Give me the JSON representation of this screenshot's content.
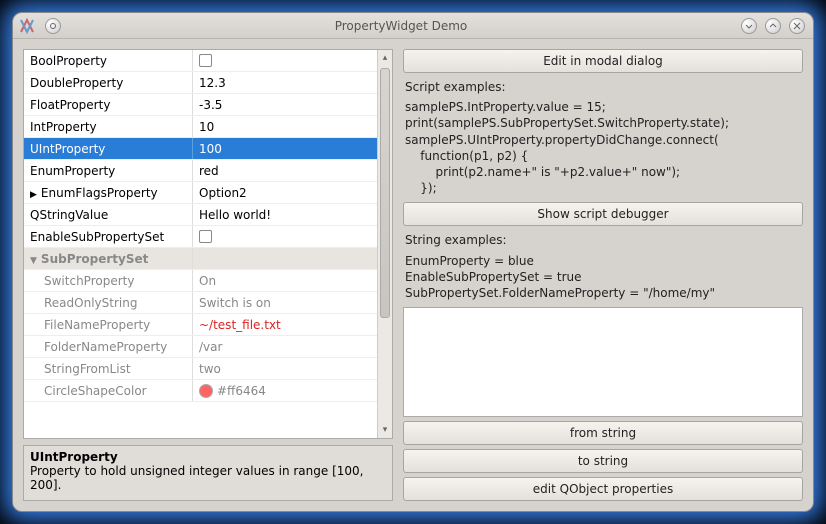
{
  "window": {
    "title": "PropertyWidget Demo"
  },
  "properties": {
    "rows": [
      {
        "name": "BoolProperty",
        "type": "checkbox",
        "value": ""
      },
      {
        "name": "DoubleProperty",
        "type": "text",
        "value": "12.3"
      },
      {
        "name": "FloatProperty",
        "type": "text",
        "value": "-3.5"
      },
      {
        "name": "IntProperty",
        "type": "text",
        "value": "10"
      },
      {
        "name": "UIntProperty",
        "type": "text",
        "value": "100",
        "selected": true
      },
      {
        "name": "EnumProperty",
        "type": "text",
        "value": "red"
      },
      {
        "name": "EnumFlagsProperty",
        "type": "text",
        "value": "Option2",
        "expandable": "right"
      },
      {
        "name": "QStringValue",
        "type": "text",
        "value": "Hello world!"
      },
      {
        "name": "EnableSubPropertySet",
        "type": "checkbox",
        "value": ""
      },
      {
        "name": "SubPropertySet",
        "type": "group",
        "value": "",
        "expandable": "down"
      },
      {
        "name": "SwitchProperty",
        "type": "text",
        "value": "On",
        "sub": true
      },
      {
        "name": "ReadOnlyString",
        "type": "text",
        "value": "Switch is on",
        "sub": true
      },
      {
        "name": "FileNameProperty",
        "type": "text",
        "value": "~/test_file.txt",
        "sub": true,
        "red": true
      },
      {
        "name": "FolderNameProperty",
        "type": "text",
        "value": "/var",
        "sub": true
      },
      {
        "name": "StringFromList",
        "type": "text",
        "value": "two",
        "sub": true
      },
      {
        "name": "CircleShapeColor",
        "type": "color",
        "value": "#ff6464",
        "sub": true
      }
    ]
  },
  "description": {
    "title": "UIntProperty",
    "body": "Property to hold unsigned integer values in range [100, 200]."
  },
  "right": {
    "edit_modal": "Edit in modal dialog",
    "script_examples_label": "Script examples:",
    "script_examples": "samplePS.IntProperty.value = 15;\nprint(samplePS.SubPropertySet.SwitchProperty.state);\nsamplePS.UIntProperty.propertyDidChange.connect(\n    function(p1, p2) {\n        print(p2.name+\" is \"+p2.value+\" now\");\n    });",
    "show_debugger": "Show script debugger",
    "string_examples_label": "String examples:",
    "string_examples": "EnumProperty = blue\nEnableSubPropertySet = true\nSubPropertySet.FolderNameProperty = \"/home/my\"",
    "from_string": "from string",
    "to_string": "to string",
    "edit_qobject": "edit QObject properties"
  }
}
